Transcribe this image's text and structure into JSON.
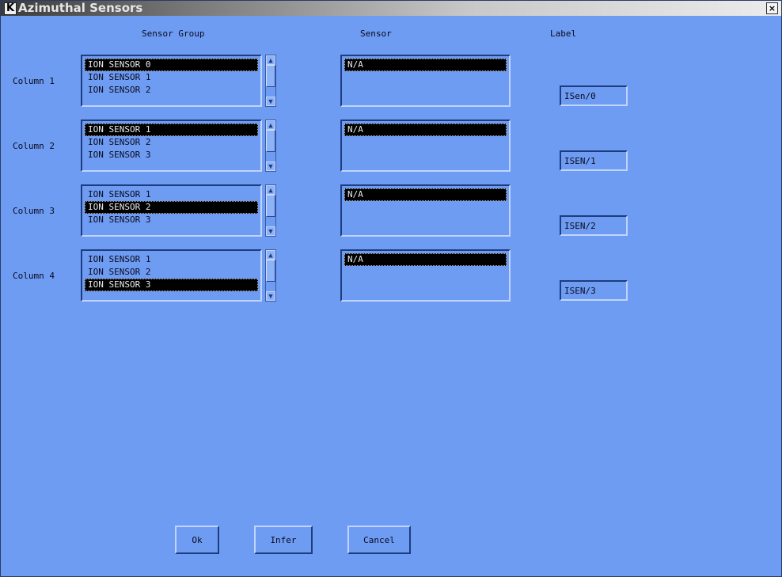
{
  "window": {
    "title": "Azimuthal Sensors",
    "app_icon": "K",
    "close_glyph": "×"
  },
  "headers": {
    "group": "Sensor Group",
    "sensor": "Sensor",
    "label": "Label"
  },
  "rows": [
    {
      "label": "Column 1",
      "groups": [
        "ION SENSOR 0",
        "ION SENSOR 1",
        "ION SENSOR 2"
      ],
      "selected_group": 0,
      "sensors": [
        "N/A"
      ],
      "selected_sensor": 0,
      "label_value": "ISen/0"
    },
    {
      "label": "Column 2",
      "groups": [
        "ION SENSOR 1",
        "ION SENSOR 2",
        "ION SENSOR 3"
      ],
      "selected_group": 0,
      "sensors": [
        "N/A"
      ],
      "selected_sensor": 0,
      "label_value": "ISEN/1"
    },
    {
      "label": "Column 3",
      "groups": [
        "ION SENSOR 1",
        "ION SENSOR 2",
        "ION SENSOR 3"
      ],
      "selected_group": 1,
      "sensors": [
        "N/A"
      ],
      "selected_sensor": 0,
      "label_value": "ISEN/2"
    },
    {
      "label": "Column 4",
      "groups": [
        "ION SENSOR 1",
        "ION SENSOR 2",
        "ION SENSOR 3"
      ],
      "selected_group": 2,
      "sensors": [
        "N/A"
      ],
      "selected_sensor": 0,
      "label_value": "ISEN/3"
    }
  ],
  "buttons": {
    "ok": "Ok",
    "infer": "Infer",
    "cancel": "Cancel"
  },
  "icons": {
    "scroll_up": "up-arrow-icon",
    "scroll_down": "down-arrow-icon",
    "close": "close-icon"
  }
}
